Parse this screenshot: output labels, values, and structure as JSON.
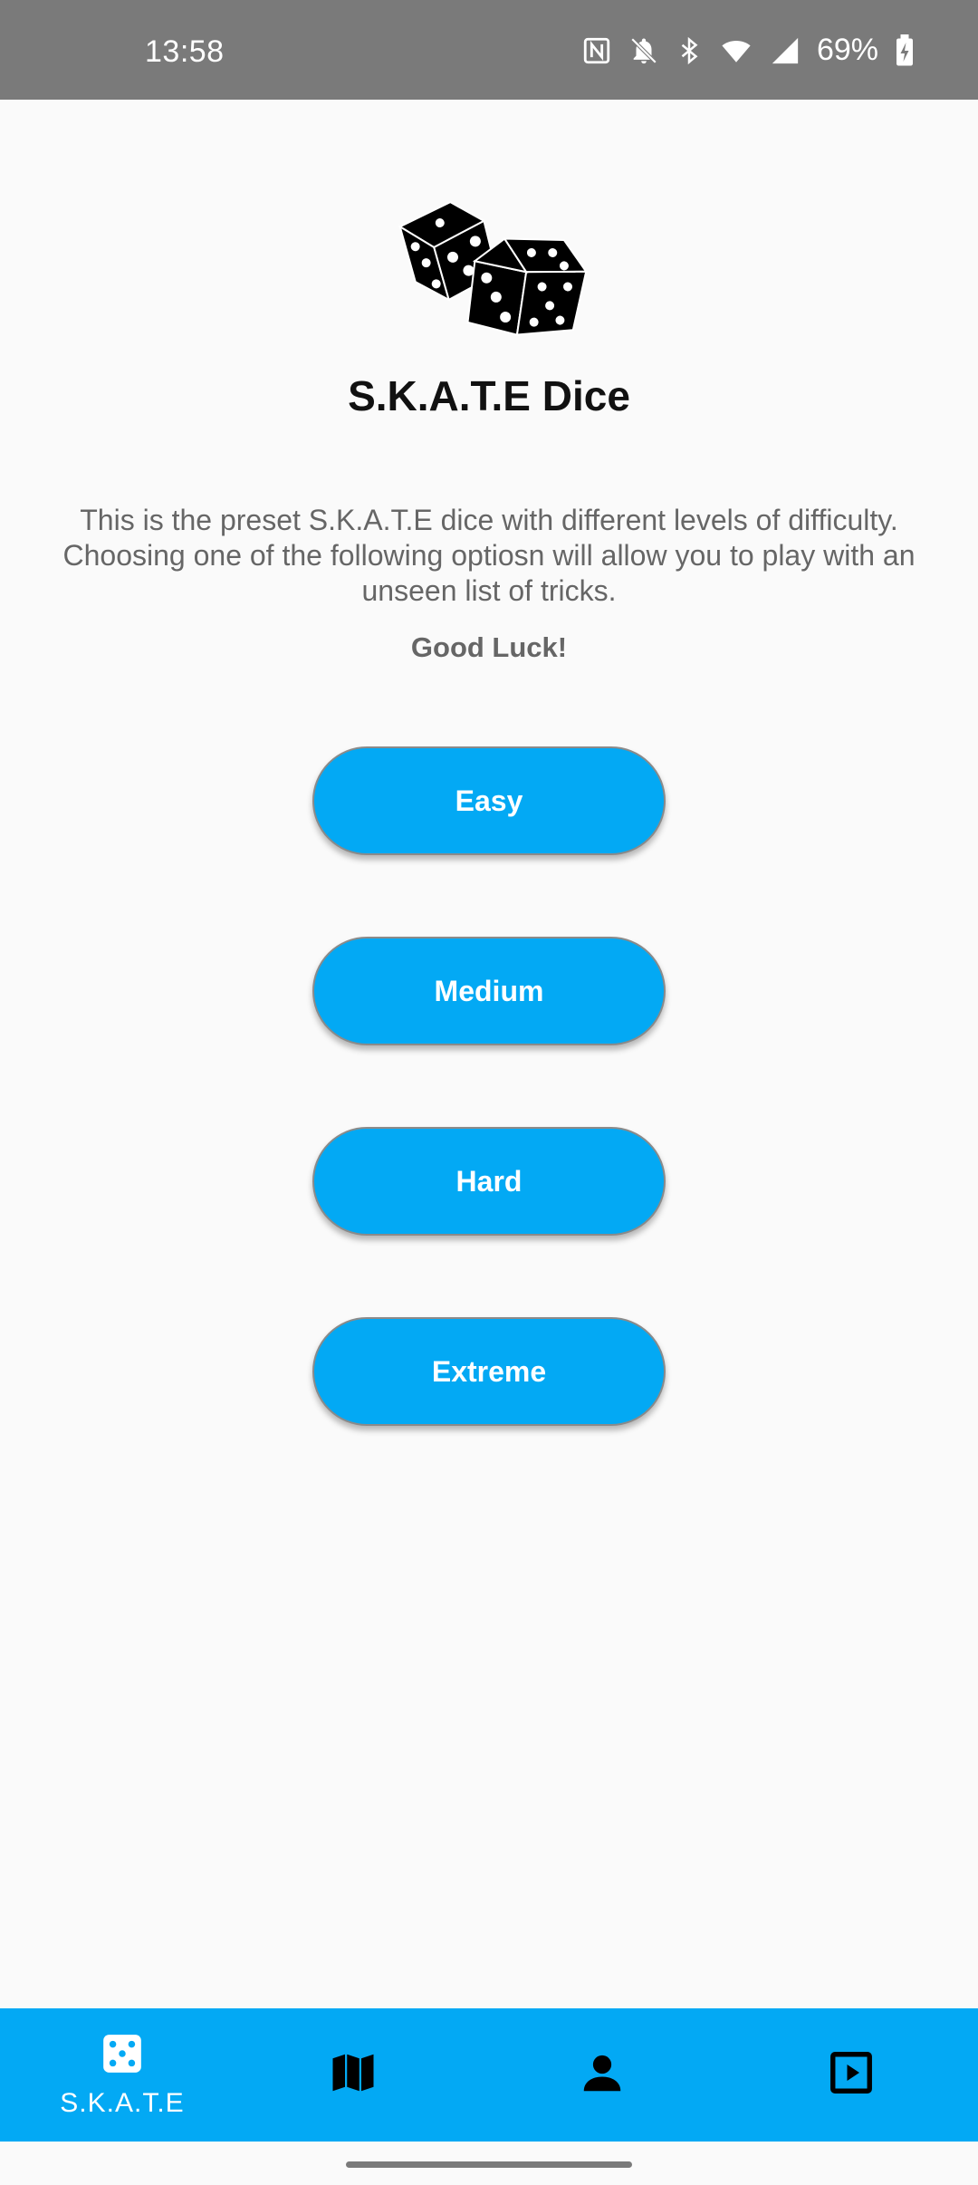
{
  "status_bar": {
    "time": "13:58",
    "battery": "69%"
  },
  "header": {
    "title": "S.K.A.T.E Dice"
  },
  "main": {
    "description": "This is the preset S.K.A.T.E dice with different levels of difficulty. Choosing one of the following optiosn will allow you to play with an unseen list of tricks.",
    "good_luck": "Good Luck!",
    "levels": [
      {
        "label": "Easy"
      },
      {
        "label": "Medium"
      },
      {
        "label": "Hard"
      },
      {
        "label": "Extreme"
      }
    ]
  },
  "bottom_nav": {
    "items": [
      {
        "label": "S.K.A.T.E",
        "icon": "dice-icon"
      },
      {
        "icon": "map-icon"
      },
      {
        "icon": "person-icon"
      },
      {
        "icon": "play-icon"
      }
    ]
  },
  "colors": {
    "accent": "#03a9f4",
    "status_bar": "#7a7a7a",
    "background": "#fafafa"
  }
}
